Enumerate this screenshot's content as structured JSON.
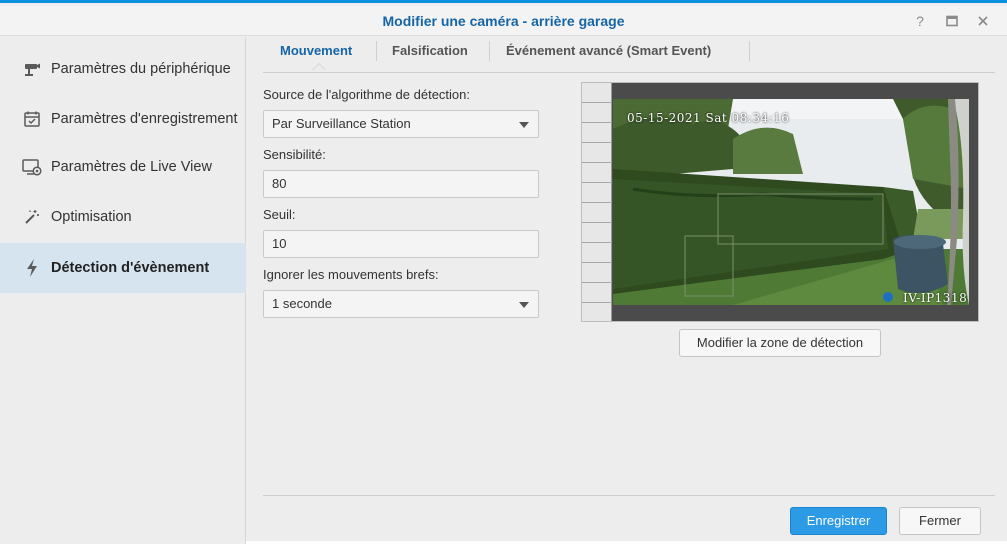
{
  "window": {
    "title": "Modifier une caméra - arrière garage",
    "controls": [
      "help-icon",
      "maximize-icon",
      "close-icon"
    ]
  },
  "sidebar": {
    "items": [
      {
        "label": "Paramètres du périphérique",
        "icon": "camera-device-icon",
        "active": false
      },
      {
        "label": "Paramètres d'enregistrement",
        "icon": "calendar-check-icon",
        "active": false
      },
      {
        "label": "Paramètres de Live View",
        "icon": "monitor-icon",
        "active": false
      },
      {
        "label": "Optimisation",
        "icon": "magic-wand-icon",
        "active": false
      },
      {
        "label": "Détection d'évènement",
        "icon": "lightning-icon",
        "active": true
      }
    ]
  },
  "tabs": [
    {
      "label": "Mouvement",
      "active": true
    },
    {
      "label": "Falsification",
      "active": false
    },
    {
      "label": "Événement avancé (Smart Event)",
      "active": false
    }
  ],
  "form": {
    "source_label": "Source de l'algorithme de détection:",
    "source_value": "Par Surveillance Station",
    "sensitivity_label": "Sensibilité:",
    "sensitivity_value": "80",
    "threshold_label": "Seuil:",
    "threshold_value": "10",
    "ignore_label": "Ignorer les mouvements brefs:",
    "ignore_value": "1 seconde"
  },
  "preview": {
    "timestamp": "05-15-2021 Sat 08:34:16",
    "camera_name": "IV-IP1318"
  },
  "buttons": {
    "edit_zone": "Modifier la zone de détection",
    "save": "Enregistrer",
    "close": "Fermer"
  },
  "colors": {
    "accent": "#1565a6",
    "primary_button": "#2d9ae6",
    "active_sidebar": "#d6e4ef"
  }
}
